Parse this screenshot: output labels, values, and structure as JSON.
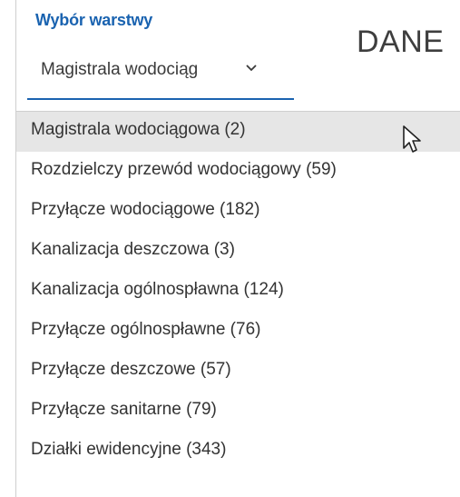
{
  "header": {
    "layer_title": "Wybór warstwy",
    "selected_layer": "Magistrala wodociąg",
    "data_tab": "DANE"
  },
  "icons": {
    "dropdown_chevron": "chevron-down-icon",
    "mouse_cursor": "mouse-pointer-icon"
  },
  "dropdown": {
    "items": [
      {
        "label": "Magistrala wodociągowa (2)",
        "selected": true
      },
      {
        "label": "Rozdzielczy przewód wodociągowy (59)",
        "selected": false
      },
      {
        "label": "Przyłącze wodociągowe (182)",
        "selected": false
      },
      {
        "label": "Kanalizacja deszczowa (3)",
        "selected": false
      },
      {
        "label": "Kanalizacja ogólnospławna (124)",
        "selected": false
      },
      {
        "label": "Przyłącze ogólnospławne (76)",
        "selected": false
      },
      {
        "label": "Przyłącze deszczowe (57)",
        "selected": false
      },
      {
        "label": "Przyłącze sanitarne (79)",
        "selected": false
      },
      {
        "label": "Działki ewidencyjne (343)",
        "selected": false
      }
    ]
  },
  "colors": {
    "accent": "#1a63b0",
    "selected_row": "#e6e6e6",
    "text": "#333333"
  }
}
